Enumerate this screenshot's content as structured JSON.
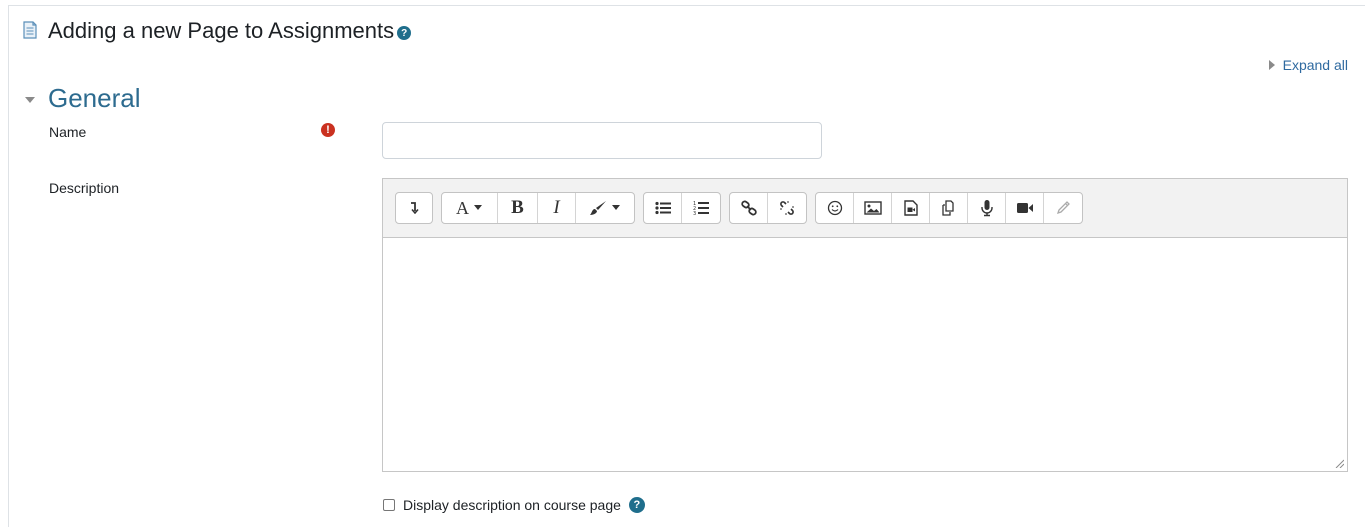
{
  "page": {
    "title": "Adding a new Page to Assignments",
    "help_glyph": "?",
    "expand_all": "Expand all"
  },
  "section": {
    "title": "General"
  },
  "form": {
    "name_label": "Name",
    "name_value": "",
    "required_glyph": "!",
    "description_label": "Description",
    "display_description_label": "Display description on course page"
  },
  "toolbar": {
    "groups": [
      [
        "collapse-icon"
      ],
      [
        "font-style-dropdown",
        "bold",
        "italic",
        "text-color-dropdown"
      ],
      [
        "unordered-list-icon",
        "ordered-list-icon"
      ],
      [
        "link-icon",
        "unlink-icon"
      ],
      [
        "emoji-icon",
        "image-icon",
        "media-icon",
        "manage-files-icon",
        "record-audio-icon",
        "record-video-icon",
        "pencil-icon"
      ]
    ],
    "font_letter": "A",
    "bold_letter": "B",
    "italic_letter": "I"
  },
  "colors": {
    "accent": "#2d6b8f",
    "required": "#ca3120",
    "help": "#1f6e8c",
    "link": "#2f6aa0"
  }
}
